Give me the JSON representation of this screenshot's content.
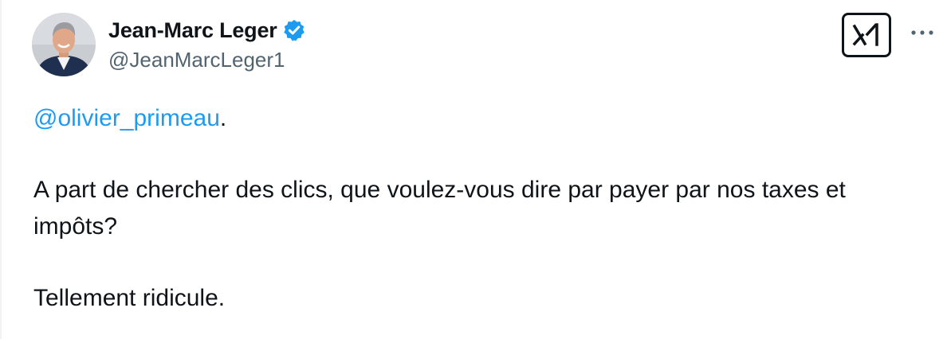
{
  "author": {
    "display_name": "Jean-Marc Leger",
    "handle": "@JeanMarcLeger1",
    "verified": true
  },
  "icons": {
    "verified": "verified-badge-icon",
    "logo": "x-grok-logo-icon",
    "more": "more-horizontal-icon"
  },
  "tweet": {
    "mention": "@olivier_primeau",
    "mention_suffix": ".",
    "paragraph_1": "A part de chercher des clics, que voulez-vous dire par payer par nos taxes et impôts?",
    "paragraph_2": "Tellement ridicule."
  },
  "colors": {
    "link": "#1d9bf0",
    "text": "#0f1419",
    "secondary": "#536471"
  }
}
